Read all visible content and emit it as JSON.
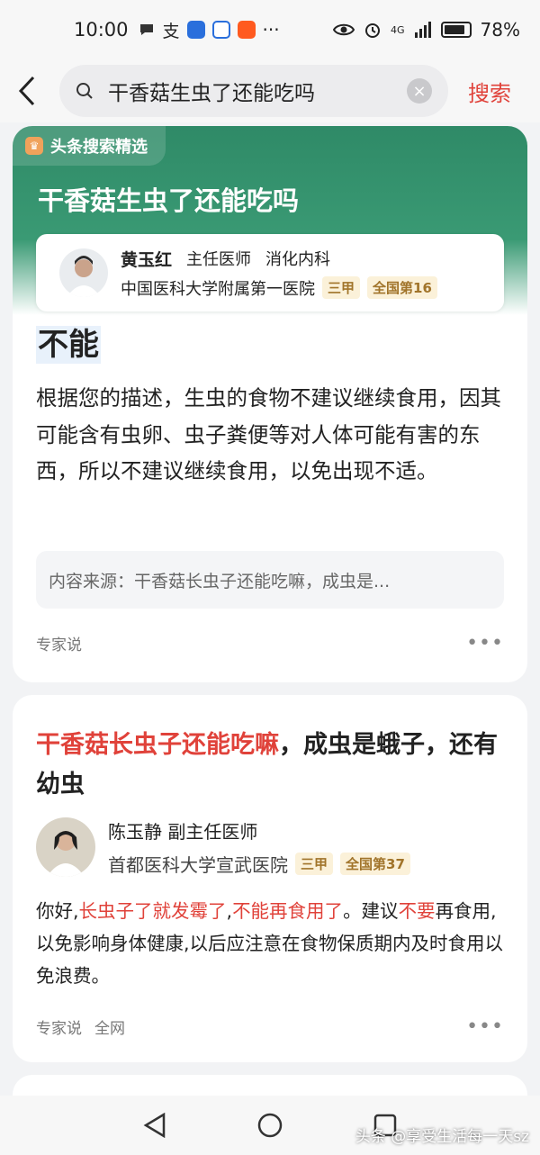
{
  "status_bar": {
    "time": "10:00",
    "network": "4G",
    "battery": "78%"
  },
  "search": {
    "query": "干香菇生虫了还能吃吗",
    "button": "搜索"
  },
  "featured_card": {
    "tag": "头条搜索精选",
    "title": "干香菇生虫了还能吃吗",
    "doctor": {
      "name": "黄玉红",
      "title": "主任医师",
      "dept": "消化内科",
      "hospital": "中国医科大学附属第一医院",
      "grade": "三甲",
      "rank": "全国第16"
    },
    "answer_head": "不能",
    "answer_body": "根据您的描述，生虫的食物不建议继续食用，因其可能含有虫卵、虫子粪便等对人体可能有害的东西，所以不建议继续食用，以免出现不适。",
    "source": "内容来源：干香菇长虫子还能吃嘛，成虫是...",
    "footer_label": "专家说",
    "more": "•••"
  },
  "card2": {
    "title_red": "干香菇长虫子还能吃嘛",
    "title_rest": "，成虫是蛾子，还有幼虫",
    "doctor": {
      "name": "陈玉静",
      "title": "副主任医师",
      "hospital": "首都医科大学宣武医院",
      "grade": "三甲",
      "rank": "全国第37"
    },
    "body_parts": [
      {
        "t": "你好,",
        "red": false
      },
      {
        "t": "长虫子了就发霉了",
        "red": true
      },
      {
        "t": ",",
        "red": false
      },
      {
        "t": "不能再食用了",
        "red": true
      },
      {
        "t": "。建议",
        "red": false
      },
      {
        "t": "不要",
        "red": true
      },
      {
        "t": "再食用,以免影响身体健康,以后应注意在食物保质期内及时食用以免浪费。",
        "red": false
      }
    ],
    "footer_label": "专家说",
    "footer_scope": "全网",
    "more": "•••"
  },
  "watermark": "头条 @享受生活每一天sz",
  "colors": {
    "accent_red": "#e0423a",
    "green": "#2f8a67"
  }
}
